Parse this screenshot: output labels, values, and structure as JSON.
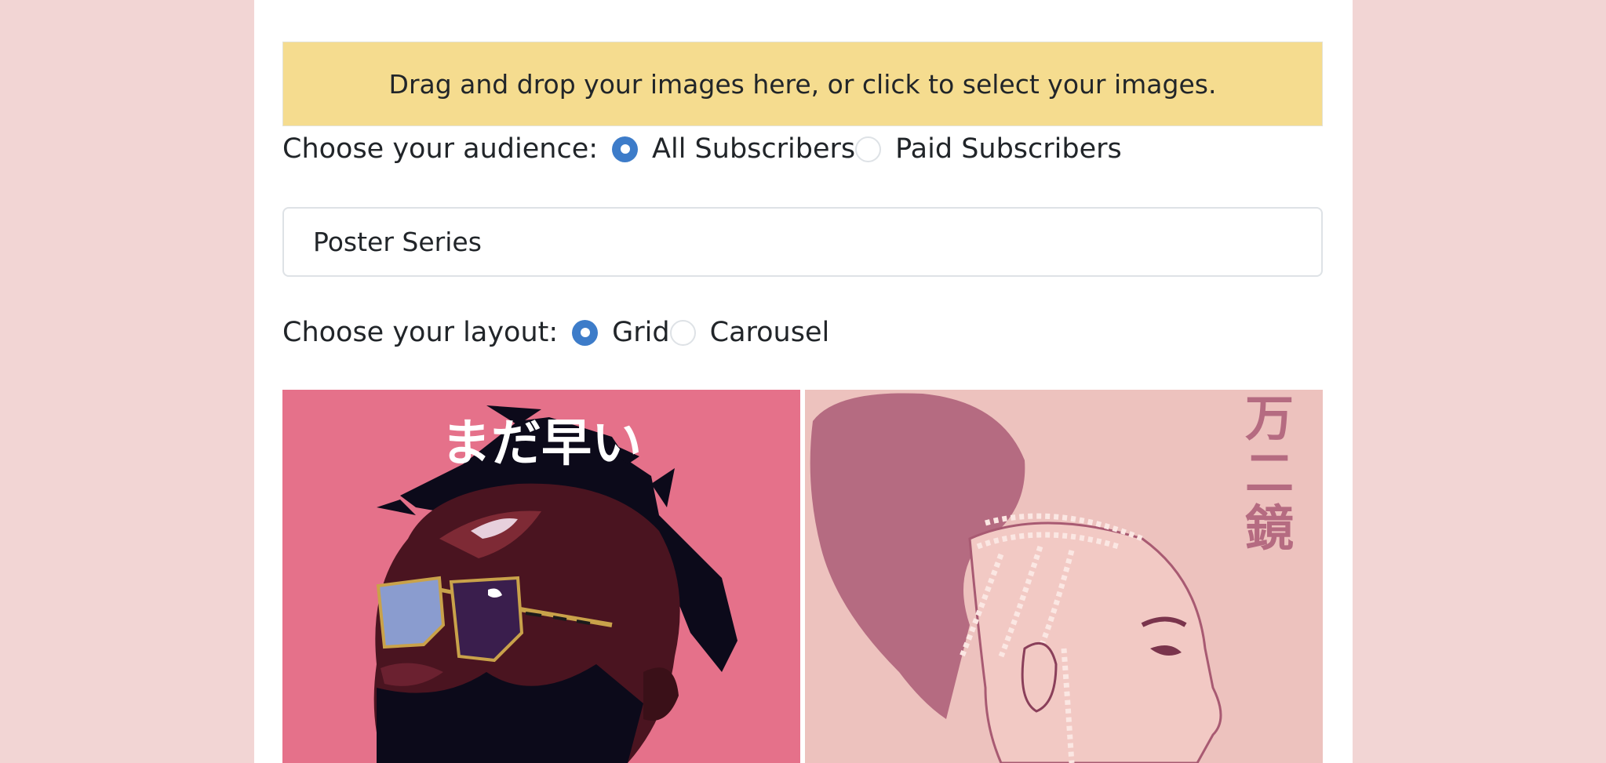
{
  "dropzone": {
    "text": "Drag and drop your images here, or click to select your images."
  },
  "audience": {
    "label": "Choose your audience:",
    "options": [
      {
        "label": "All Subscribers",
        "checked": true
      },
      {
        "label": "Paid Subscribers",
        "checked": false
      }
    ]
  },
  "title_input": {
    "value": "Poster Series"
  },
  "layout": {
    "label": "Choose your layout:",
    "options": [
      {
        "label": "Grid",
        "checked": true
      },
      {
        "label": "Carousel",
        "checked": false
      }
    ]
  },
  "gallery": {
    "images": [
      {
        "name": "poster-man-sunglasses",
        "caption_jp": "まだ早い",
        "bg_color": "#e5718a"
      },
      {
        "name": "poster-woman-braids",
        "caption_jp": "万二鏡",
        "bg_color": "#edc2be"
      }
    ]
  },
  "colors": {
    "accent": "#3d7cc9",
    "dropzone_bg": "#f5dc8f",
    "page_bg": "#f2d5d4"
  }
}
